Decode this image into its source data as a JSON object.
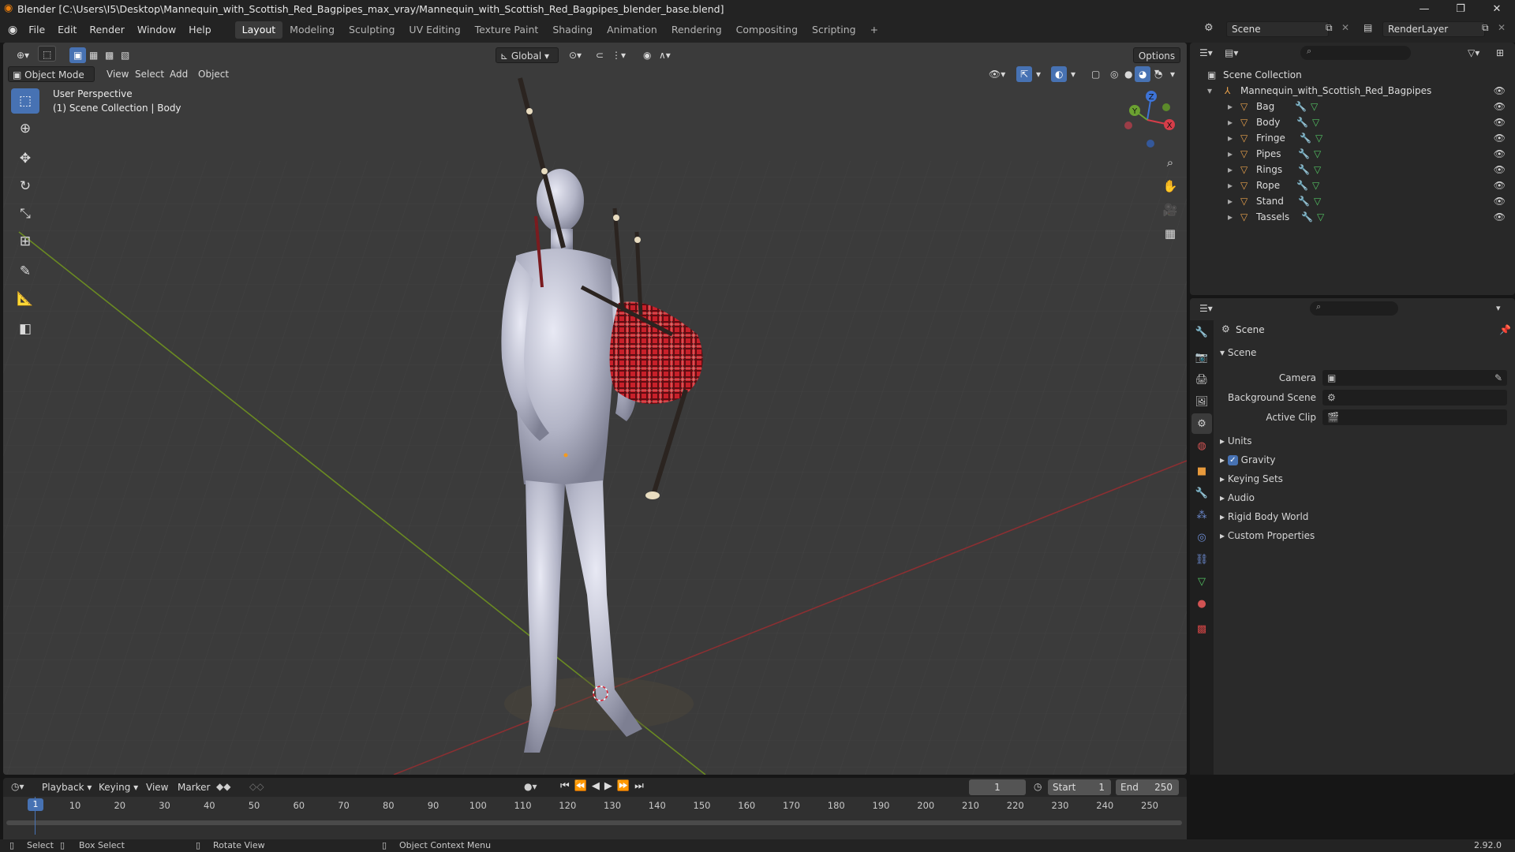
{
  "window": {
    "title": "Blender [C:\\Users\\I5\\Desktop\\Mannequin_with_Scottish_Red_Bagpipes_max_vray/Mannequin_with_Scottish_Red_Bagpipes_blender_base.blend]",
    "minimize": "—",
    "maximize": "❐",
    "close": "✕"
  },
  "menu": {
    "items": [
      "File",
      "Edit",
      "Render",
      "Window",
      "Help"
    ],
    "workspaces": [
      "Layout",
      "Modeling",
      "Sculpting",
      "UV Editing",
      "Texture Paint",
      "Shading",
      "Animation",
      "Rendering",
      "Compositing",
      "Scripting"
    ],
    "add_tab": "+",
    "scene_label": "Scene",
    "renderlayer_label": "RenderLayer"
  },
  "viewport": {
    "mode": "Object Mode",
    "menus": [
      "View",
      "Select",
      "Add",
      "Object"
    ],
    "transform_orientation": "Global",
    "options": "Options",
    "overlay_line1": "User Perspective",
    "overlay_line2": "(1) Scene Collection | Body",
    "gizmo": {
      "x": "X",
      "y": "Y",
      "z": "Z"
    }
  },
  "outliner": {
    "root": "Scene Collection",
    "collection": "Mannequin_with_Scottish_Red_Bagpipes",
    "objects": [
      "Bag",
      "Body",
      "Fringe",
      "Pipes",
      "Rings",
      "Rope",
      "Stand",
      "Tassels"
    ]
  },
  "properties": {
    "breadcrumb": "Scene",
    "section": "Scene",
    "camera_label": "Camera",
    "camera_value": "",
    "background_scene_label": "Background Scene",
    "background_scene_value": "",
    "active_clip_label": "Active Clip",
    "active_clip_value": "",
    "panels": [
      "Units",
      "Gravity",
      "Keying Sets",
      "Audio",
      "Rigid Body World",
      "Custom Properties"
    ],
    "gravity_checked": true
  },
  "timeline": {
    "menus": [
      "Playback",
      "Keying",
      "View",
      "Marker"
    ],
    "current_frame": "1",
    "start_label": "Start",
    "start_value": "1",
    "end_label": "End",
    "end_value": "250",
    "ticks": [
      "1",
      "10",
      "20",
      "30",
      "40",
      "50",
      "60",
      "70",
      "80",
      "90",
      "100",
      "110",
      "120",
      "130",
      "140",
      "150",
      "160",
      "170",
      "180",
      "190",
      "200",
      "210",
      "220",
      "230",
      "240",
      "250"
    ],
    "playhead": "1"
  },
  "status": {
    "select": "Select",
    "box_select": "Box Select",
    "rotate_view": "Rotate View",
    "context_menu": "Object Context Menu",
    "version": "2.92.0"
  },
  "colors": {
    "accent": "#4772b3",
    "x_axis": "#8b2f32",
    "y_axis": "#6a8a22",
    "tartan": "#c8202a"
  }
}
